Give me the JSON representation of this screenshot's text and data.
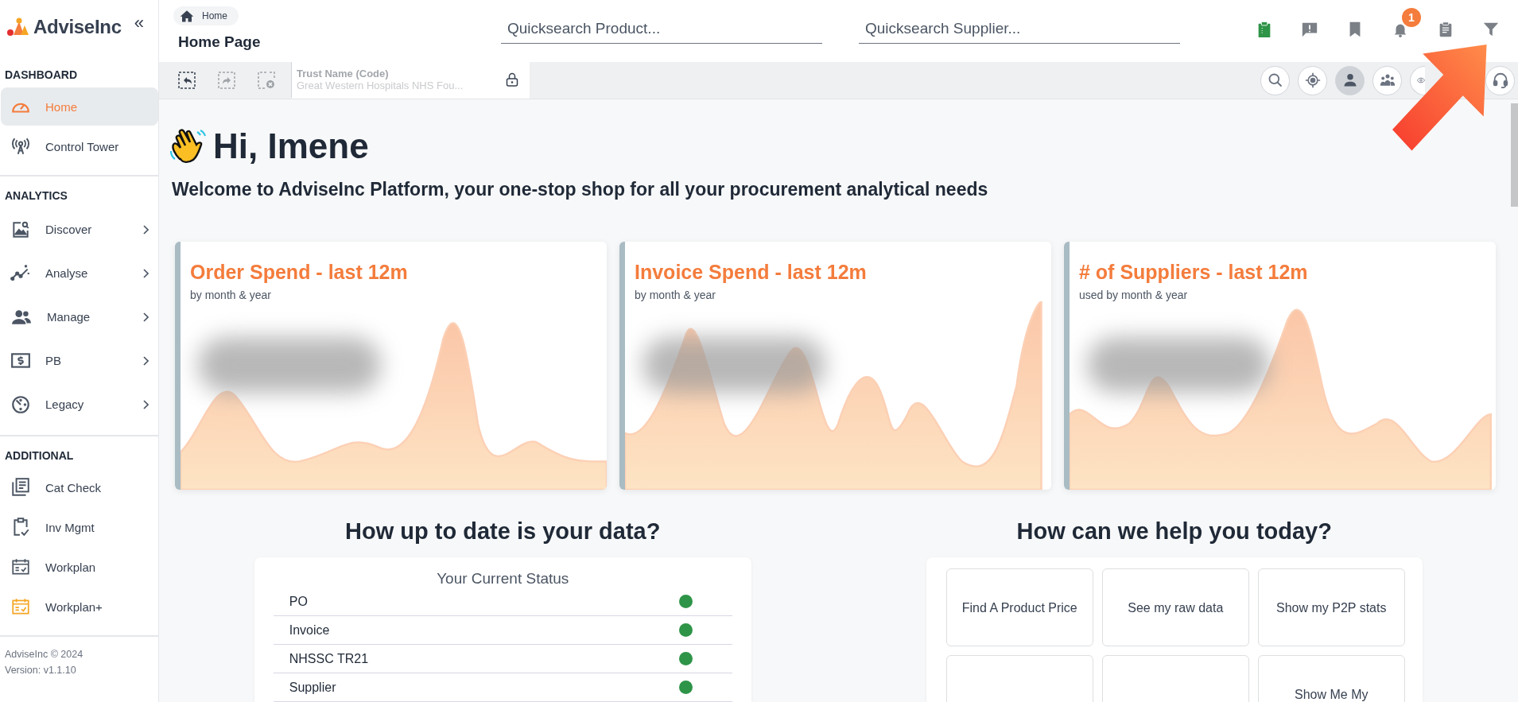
{
  "sidebar": {
    "logo": "AdviseInc",
    "collapse": "«",
    "sections": [
      {
        "title": "DASHBOARD",
        "items": [
          {
            "label": "Home",
            "selected": true,
            "submenu": false
          },
          {
            "label": "Control Tower",
            "selected": false,
            "submenu": false
          }
        ]
      },
      {
        "title": "ANALYTICS",
        "items": [
          {
            "label": "Discover",
            "selected": false,
            "submenu": true
          },
          {
            "label": "Analyse",
            "selected": false,
            "submenu": true
          },
          {
            "label": "Manage",
            "selected": false,
            "submenu": true
          },
          {
            "label": "PB",
            "selected": false,
            "submenu": true
          },
          {
            "label": "Legacy",
            "selected": false,
            "submenu": true
          }
        ]
      },
      {
        "title": "ADDITIONAL",
        "items": [
          {
            "label": "Cat Check",
            "selected": false,
            "submenu": false
          },
          {
            "label": "Inv Mgmt",
            "selected": false,
            "submenu": false
          },
          {
            "label": "Workplan",
            "selected": false,
            "submenu": false
          },
          {
            "label": "Workplan+",
            "selected": false,
            "submenu": false
          }
        ]
      }
    ],
    "footer": [
      "AdviseInc © 2024",
      "Version: v1.1.10"
    ]
  },
  "header": {
    "breadcrumb": "Home",
    "page_title": "Home Page",
    "searches": [
      {
        "placeholder": "Quicksearch Product..."
      },
      {
        "placeholder": "Quicksearch Supplier..."
      }
    ],
    "toolbar_icons": [
      {
        "kind": "clipboard-green"
      },
      {
        "kind": "feedback"
      },
      {
        "kind": "bookmark"
      },
      {
        "kind": "bell",
        "badge": "1"
      },
      {
        "kind": "clipboard"
      },
      {
        "kind": "filter"
      }
    ]
  },
  "actions": {
    "buttons": [
      {
        "kind": "undo"
      },
      {
        "kind": "redo"
      },
      {
        "kind": "clear"
      }
    ],
    "trust_field": {
      "label": "Trust Name (Code)",
      "value": "Great Western Hospitals NHS Fou..."
    },
    "view_buttons": [
      {
        "kind": "search",
        "selected": false
      },
      {
        "kind": "target",
        "selected": false
      },
      {
        "kind": "person",
        "selected": true
      },
      {
        "kind": "group",
        "selected": false
      },
      {
        "kind": "eye",
        "selected": false
      },
      {
        "kind": "headset",
        "selected": false
      }
    ]
  },
  "greeting": "Hi, Imene",
  "welcome": "Welcome to AdviseInc Platform, your one-stop shop for all your procurement analytical needs",
  "cards": [
    {
      "title": "Order Spend - last 12m",
      "subtitle": "by month & year"
    },
    {
      "title": "Invoice Spend - last 12m",
      "subtitle": "by month & year"
    },
    {
      "title": "# of Suppliers - last 12m",
      "subtitle": "used by month & year"
    }
  ],
  "data_status": {
    "heading": "How up to date is your data?",
    "title": "Your Current Status",
    "rows": [
      {
        "label": "PO",
        "color": "#2e9447"
      },
      {
        "label": "Invoice",
        "color": "#2e9447"
      },
      {
        "label": "NHSSC TR21",
        "color": "#2e9447"
      },
      {
        "label": "Supplier",
        "color": "#2e9447"
      }
    ]
  },
  "help": {
    "heading": "How can we help you today?",
    "buttons": [
      {
        "label": "Find A Product Price"
      },
      {
        "label": "See my raw data"
      },
      {
        "label": "Show my P2P stats"
      },
      {
        "label": "Show Me My"
      }
    ]
  }
}
